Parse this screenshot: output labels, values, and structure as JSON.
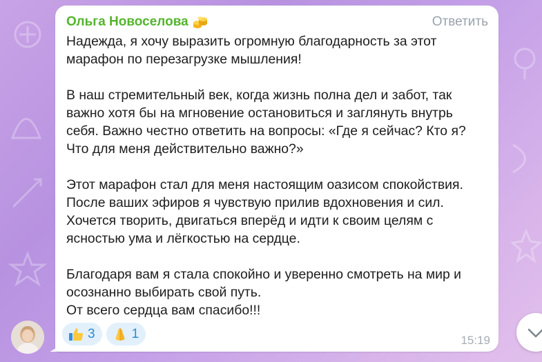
{
  "message": {
    "sender_name": "Ольга Новоселова",
    "sender_badge_icon": "coins-emoji-icon",
    "reply_label": "Ответить",
    "paragraphs": [
      [
        "Надежда, я хочу выразить огромную благодарность за этот",
        "марафон по перезагрузке мышления!"
      ],
      [
        "В наш стремительный век, когда жизнь полна дел и забот, так",
        "важно хотя бы на мгновение остановиться и заглянуть внутрь",
        "себя. Важно честно ответить на вопросы: «Где я сейчас? Кто я?",
        "Что для меня действительно важно?»"
      ],
      [
        "Этот марафон стал для меня настоящим оазисом спокойствия.",
        "После ваших эфиров я чувствую прилив вдохновения и сил.",
        "Хочется творить, двигаться вперёд и идти к своим целям с",
        "ясностью ума и лёгкостью на сердце."
      ],
      [
        "Благодаря вам я стала  спокойно и уверенно смотреть на мир и",
        "осознанно выбирать свой путь.",
        "От всего сердца вам спасибо!!!"
      ]
    ],
    "time": "15:19",
    "reactions": [
      {
        "icon": "thumbs-up-icon",
        "count": "3"
      },
      {
        "icon": "praying-hands-icon",
        "count": "1"
      }
    ]
  },
  "colors": {
    "sender": "#55b42f",
    "reaction_bg": "#e1f0fb",
    "reaction_text": "#2f8bd0",
    "background_accent": "#c4a0e8"
  },
  "scroll_button_icon": "chevron-down-icon"
}
